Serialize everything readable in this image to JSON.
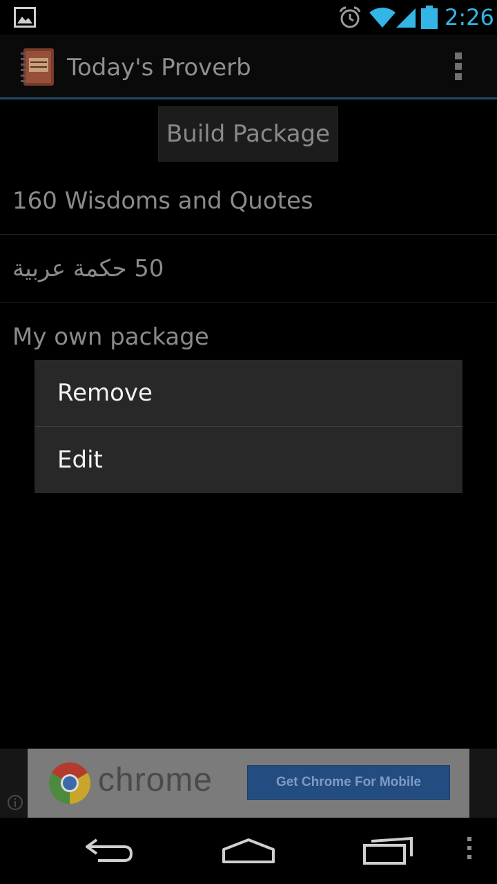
{
  "status_bar": {
    "time": "2:26",
    "icons": [
      "gallery-icon",
      "alarm-icon",
      "wifi-icon",
      "signal-icon",
      "battery-icon"
    ],
    "accent_color": "#33b5e5"
  },
  "action_bar": {
    "title": "Today's Proverb",
    "app_icon": "proverb-book-icon",
    "overflow_icon": "overflow-menu-icon"
  },
  "main": {
    "build_button_label": "Build Package",
    "packages": [
      {
        "label": "160 Wisdoms and Quotes"
      },
      {
        "label": "50 حكمة عربية"
      },
      {
        "label": "My own package"
      }
    ]
  },
  "context_menu": {
    "items": [
      {
        "label": "Remove"
      },
      {
        "label": "Edit"
      }
    ]
  },
  "ad": {
    "brand": "chrome",
    "cta": "Get Chrome For Mobile",
    "logo": "chrome-logo-icon",
    "info_icon": "info-icon"
  },
  "nav_bar": {
    "icons": [
      "back-icon",
      "home-icon",
      "recents-icon",
      "menu-icon"
    ]
  }
}
